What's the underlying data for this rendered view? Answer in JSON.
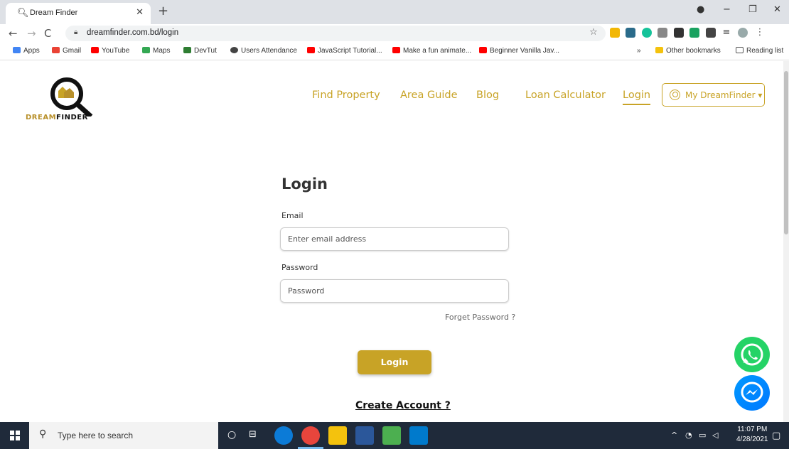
{
  "browser": {
    "tab_title": "Dream Finder",
    "url": "dreamfinder.com.bd/login",
    "bookmarks": [
      "Apps",
      "Gmail",
      "YouTube",
      "Maps",
      "DevTut",
      "Users Attendance",
      "JavaScript Tutorial...",
      "Make a fun animate...",
      "Beginner Vanilla Jav..."
    ],
    "other_bookmarks": "Other bookmarks",
    "reading_list": "Reading list",
    "more": "»"
  },
  "site": {
    "logo_text_a": "DREAM",
    "logo_text_b": "FINDER",
    "nav": [
      "Find Property",
      "Area Guide",
      "Blog",
      "Loan Calculator",
      "Login"
    ],
    "account_button": "My DreamFinder ▾",
    "accent": "#c8a326"
  },
  "form": {
    "title": "Login",
    "email_label": "Email",
    "email_placeholder": "Enter email address",
    "password_label": "Password",
    "password_placeholder": "Password",
    "forget": "Forget Password ?",
    "login_button": "Login",
    "create_account": "Create Account ?"
  },
  "taskbar": {
    "search_placeholder": "Type here to search",
    "time": "11:07 PM",
    "date": "4/28/2021"
  }
}
